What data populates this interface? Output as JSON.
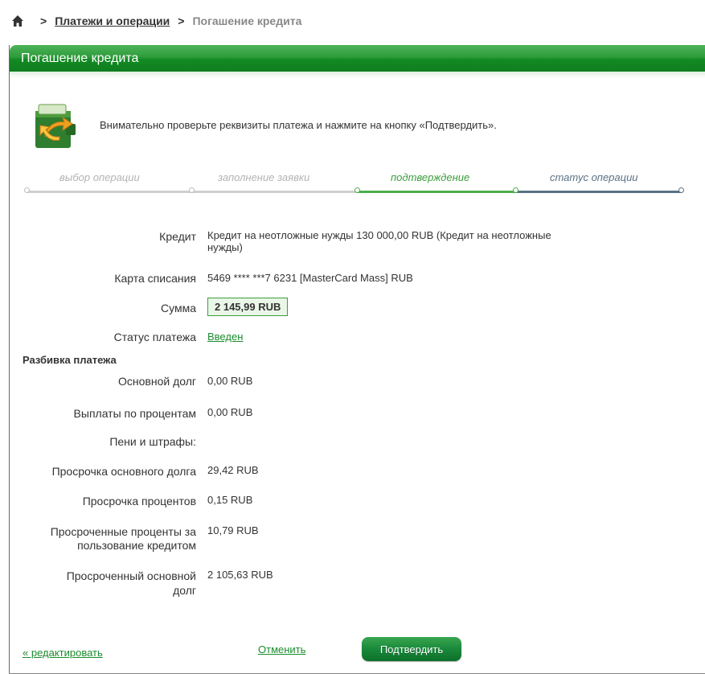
{
  "breadcrumb": {
    "section": "Платежи и операции",
    "current": "Погашение кредита",
    "separator": ">"
  },
  "panel": {
    "title": "Погашение кредита",
    "intro": "Внимательно проверьте реквизиты платежа и нажмите на кнопку «Подтвердить»."
  },
  "steps": [
    {
      "label": "выбор операции",
      "state": "done"
    },
    {
      "label": "заполнение заявки",
      "state": "done"
    },
    {
      "label": "подтверждение",
      "state": "active"
    },
    {
      "label": "статус операции",
      "state": "pending"
    }
  ],
  "form": {
    "credit_label": "Кредит",
    "credit_value_line1": "Кредит на неотложные нужды  130 000,00  RUB  (Кредит на неотложные",
    "credit_value_line2": "нужды)",
    "card_label": "Карта списания",
    "card_value": "5469 **** ***7 6231  [MasterCard Mass]  RUB",
    "amount_label": "Сумма",
    "amount_value": "2 145,99 RUB",
    "status_label": "Статус платежа",
    "status_value": "Введен"
  },
  "breakdown": {
    "title": "Разбивка платежа",
    "rows": [
      {
        "label": "Основной долг",
        "value": "0,00 RUB"
      },
      {
        "label": "Выплаты по процентам",
        "value": "0,00 RUB"
      },
      {
        "label": "Пени и штрафы:",
        "value": ""
      },
      {
        "label": "Просрочка основного долга",
        "value": "29,42 RUB"
      },
      {
        "label": "Просрочка процентов",
        "value": "0,15 RUB"
      },
      {
        "label_line1": "Просроченные проценты за",
        "label_line2": "пользование кредитом",
        "value": "10,79 RUB"
      },
      {
        "label_line1": "Просроченный основной",
        "label_line2": "долг",
        "value": "2 105,63 RUB"
      }
    ]
  },
  "actions": {
    "edit": "« редактировать",
    "cancel": "Отменить",
    "confirm": "Подтвердить"
  },
  "colors": {
    "accent_green": "#1b8c2e",
    "step_done": "#cccccc",
    "step_active": "#4caf50",
    "step_pending": "#5a7184"
  },
  "icons": {
    "home": "home-icon",
    "operation": "wallet-arrows-icon"
  }
}
